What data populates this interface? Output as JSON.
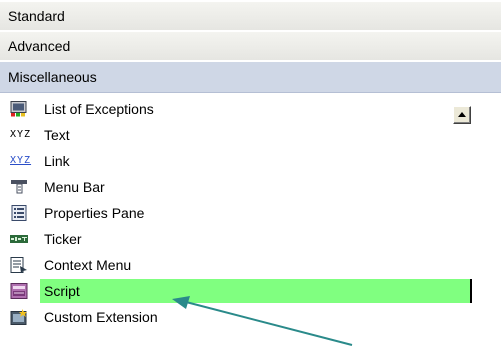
{
  "sections": {
    "standard": "Standard",
    "advanced": "Advanced",
    "miscellaneous": "Miscellaneous"
  },
  "items": [
    {
      "label": "List of Exceptions",
      "icon": "list-of-exceptions-icon"
    },
    {
      "label": "Text",
      "icon": "text-icon"
    },
    {
      "label": "Link",
      "icon": "link-icon"
    },
    {
      "label": "Menu Bar",
      "icon": "menu-bar-icon"
    },
    {
      "label": "Properties Pane",
      "icon": "properties-pane-icon"
    },
    {
      "label": "Ticker",
      "icon": "ticker-icon"
    },
    {
      "label": "Context Menu",
      "icon": "context-menu-icon"
    },
    {
      "label": "Script",
      "icon": "script-icon",
      "selected": true
    },
    {
      "label": "Custom Extension",
      "icon": "custom-extension-icon"
    }
  ],
  "icon_text": {
    "text": "XYZ",
    "link": "XYZ"
  },
  "colors": {
    "selection": "#80ff80",
    "arrow": "#2a8a8a",
    "misc_header": "#cfd7e6"
  }
}
